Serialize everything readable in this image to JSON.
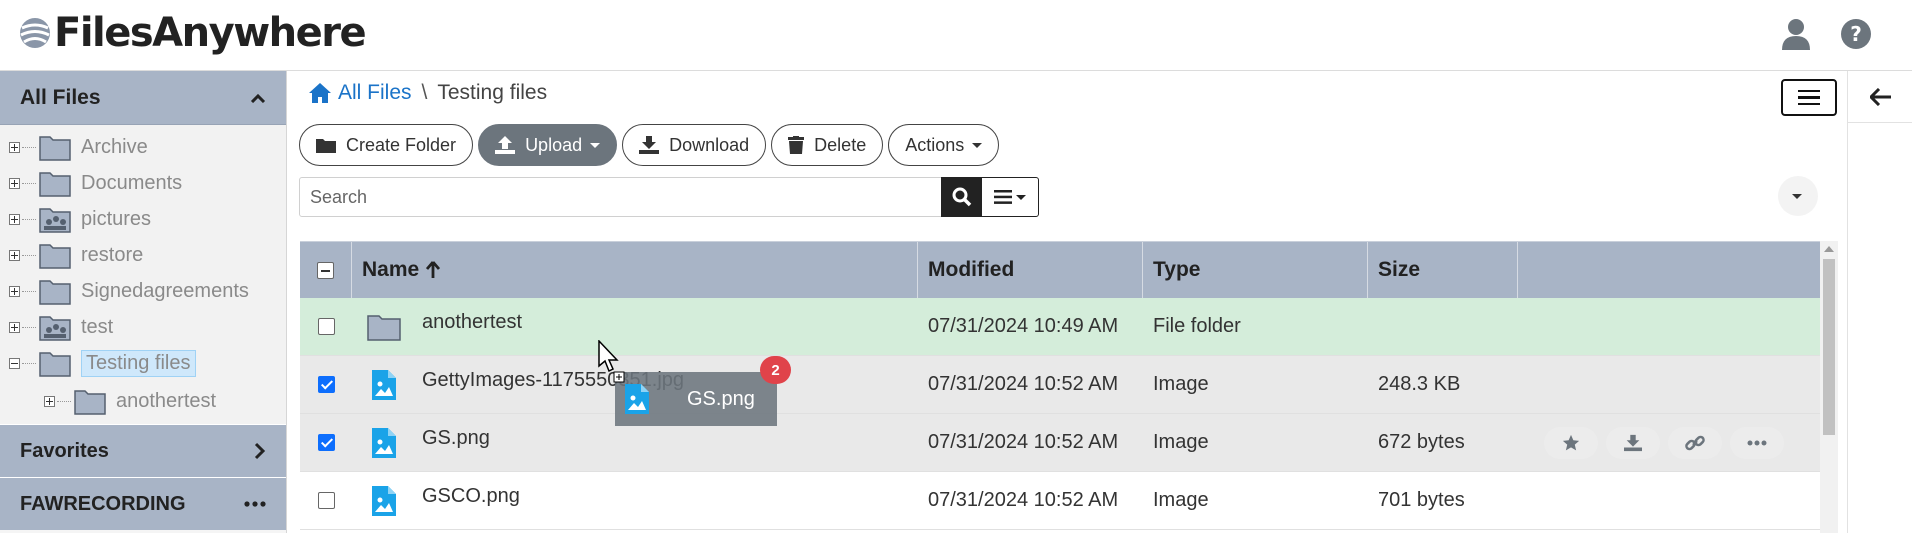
{
  "app": {
    "brand": "FilesAnywhere"
  },
  "sidebar": {
    "header": "All Files",
    "tree": [
      {
        "label": "Archive",
        "icon": "folder-icon"
      },
      {
        "label": "Documents",
        "icon": "folder-icon"
      },
      {
        "label": "pictures",
        "icon": "photo-folder-icon"
      },
      {
        "label": "restore",
        "icon": "folder-icon"
      },
      {
        "label": "Signedagreements",
        "icon": "folder-icon"
      },
      {
        "label": "test",
        "icon": "photo-folder-icon"
      },
      {
        "label": "Testing files",
        "icon": "folder-icon",
        "selected": true,
        "expanded": true
      },
      {
        "label": "anothertest",
        "icon": "folder-icon",
        "child": true
      }
    ],
    "sections": [
      {
        "label": "Favorites",
        "icon": "chevron-right-icon"
      },
      {
        "label": "FAWRECORDING",
        "icon": "ellipsis-icon"
      }
    ]
  },
  "breadcrumb": {
    "home": "All Files",
    "separator": "\\",
    "current": "Testing files"
  },
  "toolbar": {
    "create_folder": "Create Folder",
    "upload": "Upload",
    "download": "Download",
    "delete": "Delete",
    "actions": "Actions"
  },
  "search": {
    "placeholder": "Search"
  },
  "table": {
    "columns": [
      "Name",
      "Modified",
      "Type",
      "Size"
    ],
    "rows": [
      {
        "name": "anothertest",
        "modified": "07/31/2024 10:49 AM",
        "type": "File folder",
        "size": "",
        "checked": false,
        "kind": "folder"
      },
      {
        "name": "GettyImages-1175550351.jpg",
        "modified": "07/31/2024 10:52 AM",
        "type": "Image",
        "size": "248.3 KB",
        "checked": true,
        "kind": "image"
      },
      {
        "name": "GS.png",
        "modified": "07/31/2024 10:52 AM",
        "type": "Image",
        "size": "672 bytes",
        "checked": true,
        "kind": "image"
      },
      {
        "name": "GSCO.png",
        "modified": "07/31/2024 10:52 AM",
        "type": "Image",
        "size": "701 bytes",
        "checked": false,
        "kind": "image"
      }
    ]
  },
  "drag": {
    "label": "GS.png",
    "count": "2"
  },
  "colors": {
    "header_bg": "#a8b4c6",
    "link": "#1a73c8",
    "highlight_row": "#d4edda",
    "selected_row": "#e9e9e9",
    "badge": "#e0434a",
    "image_icon": "#1aa3e8"
  }
}
